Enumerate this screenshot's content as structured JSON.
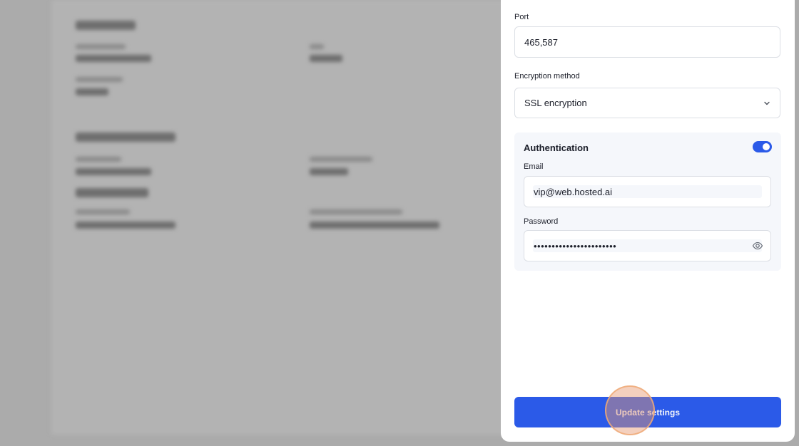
{
  "drawer": {
    "port": {
      "label": "Port",
      "value": "465,587"
    },
    "encryption": {
      "label": "Encryption method",
      "value": "SSL encryption"
    },
    "authentication": {
      "title": "Authentication",
      "enabled": true,
      "email": {
        "label": "Email",
        "value": "vip@web.hosted.ai"
      },
      "password": {
        "label": "Password",
        "value": "•••••••••••••••••••••••"
      }
    },
    "submit_label": "Update settings"
  },
  "colors": {
    "accent": "#2b5ae8",
    "overlay": "#ababab",
    "card_bg": "#f5f7fb"
  },
  "icons": {
    "select": "chevron-down-icon",
    "password_toggle": "eye-icon"
  }
}
